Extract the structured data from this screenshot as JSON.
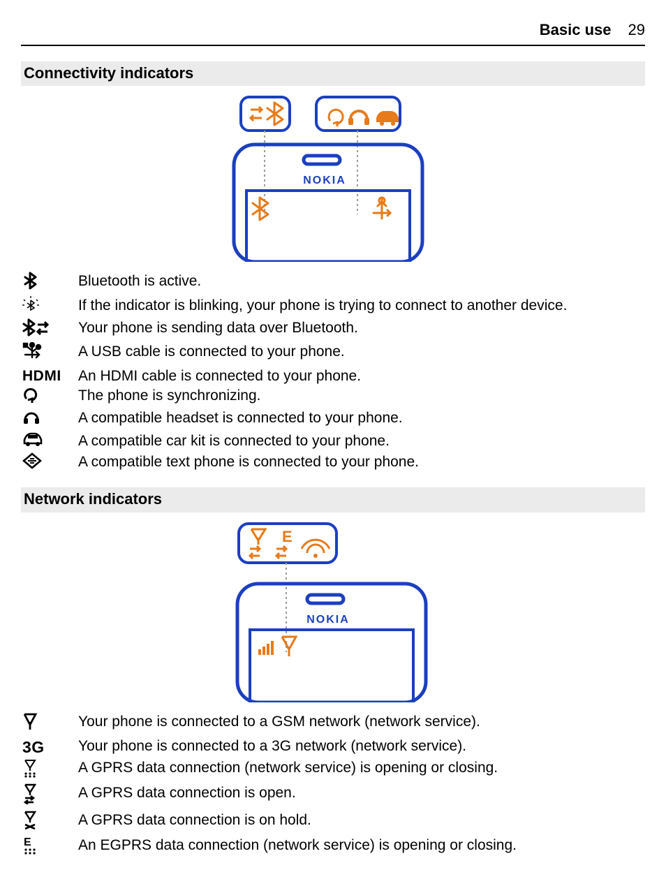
{
  "header": {
    "section": "Basic use",
    "page": "29"
  },
  "sections": {
    "connectivity": {
      "title": "Connectivity indicators",
      "items": [
        {
          "icon": "bluetooth",
          "text": "Bluetooth is active."
        },
        {
          "icon": "bluetooth-blink",
          "text": "If the indicator is blinking, your phone is trying to connect to another device."
        },
        {
          "icon": "bluetooth-arrows",
          "text": "Your phone is sending data over Bluetooth."
        },
        {
          "icon": "usb",
          "text": "A USB cable is connected to your phone."
        },
        {
          "icon": "hdmi",
          "text": "An HDMI cable is connected to your phone."
        },
        {
          "icon": "sync",
          "text": "The phone is synchronizing."
        },
        {
          "icon": "headset",
          "text": "A compatible headset is connected to your phone."
        },
        {
          "icon": "car",
          "text": "A compatible car kit is connected to your phone."
        },
        {
          "icon": "text-phone",
          "text": "A compatible text phone is connected to your phone."
        }
      ]
    },
    "network": {
      "title": "Network indicators",
      "items": [
        {
          "icon": "gsm-antenna",
          "text": "Your phone is connected to a GSM network (network service)."
        },
        {
          "icon": "3g",
          "text": "Your phone is connected to a 3G network (network service)."
        },
        {
          "icon": "gprs-dots",
          "text": "A GPRS data connection (network service) is opening or closing."
        },
        {
          "icon": "gprs-open",
          "text": "A GPRS data connection is open."
        },
        {
          "icon": "gprs-hold",
          "text": "A GPRS data connection is on hold."
        },
        {
          "icon": "egprs-dots",
          "text": "An EGPRS data connection (network service) is opening or closing."
        }
      ]
    }
  },
  "diagram_labels": {
    "nokia": "NOKIA",
    "hdmi": "HDMI",
    "three_g": "3G",
    "e": "E"
  }
}
